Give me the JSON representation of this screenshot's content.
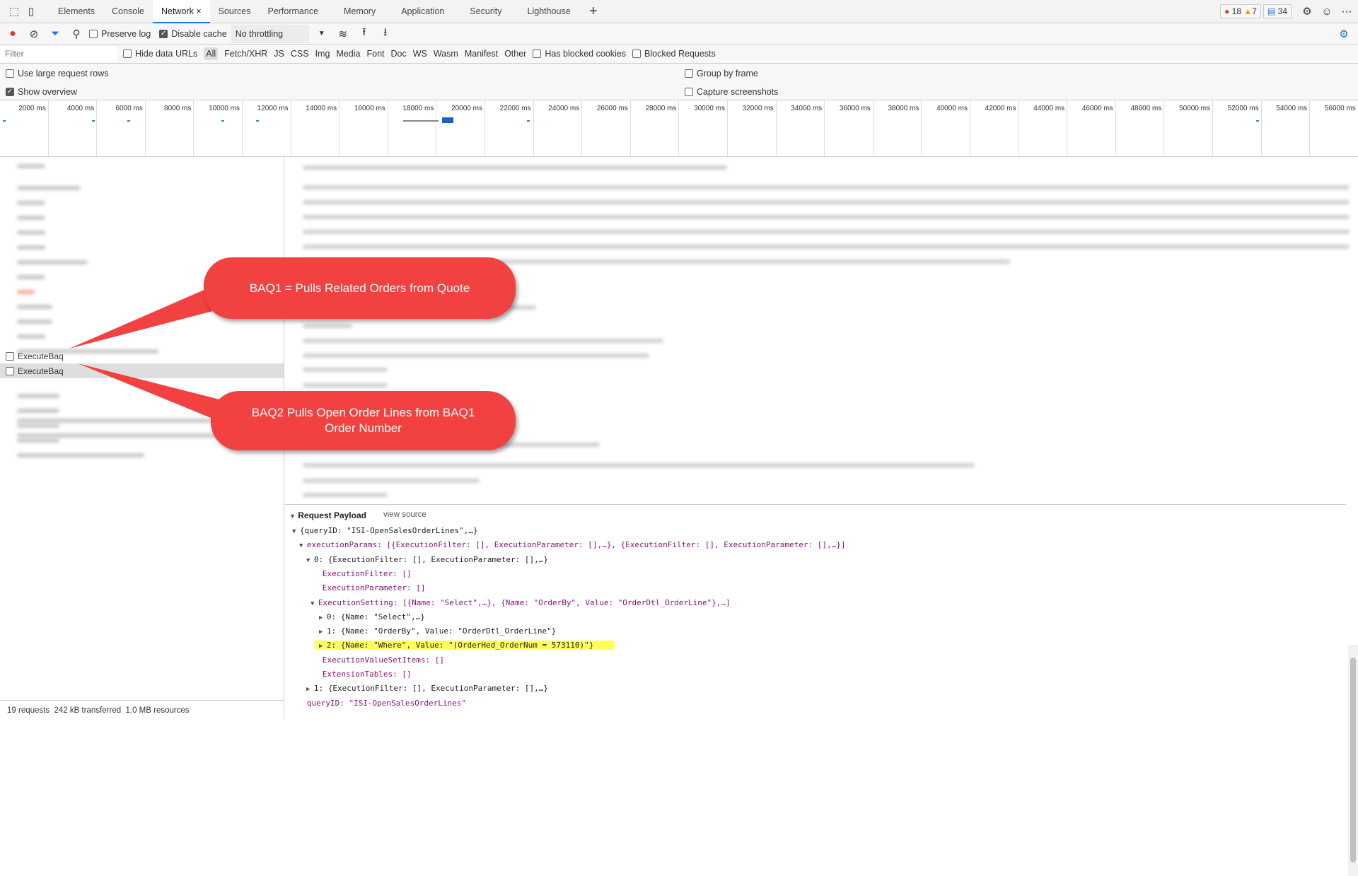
{
  "tabs": [
    "Elements",
    "Console",
    "Network",
    "Sources",
    "Performance",
    "Memory",
    "Application",
    "Security",
    "Lighthouse"
  ],
  "active_tab": "Network",
  "badges": {
    "errors": "18",
    "warnings": "7",
    "messages": "34"
  },
  "toolbar": {
    "preserve_log": "Preserve log",
    "disable_cache": "Disable cache",
    "throttling": "No throttling"
  },
  "filter": {
    "placeholder": "Filter",
    "hide_data_urls": "Hide data URLs",
    "types": [
      "All",
      "Fetch/XHR",
      "JS",
      "CSS",
      "Img",
      "Media",
      "Font",
      "Doc",
      "WS",
      "Wasm",
      "Manifest",
      "Other"
    ],
    "has_blocked_cookies": "Has blocked cookies",
    "blocked_requests": "Blocked Requests"
  },
  "options": {
    "large_rows": "Use large request rows",
    "show_overview": "Show overview",
    "group_by_frame": "Group by frame",
    "capture_screenshots": "Capture screenshots"
  },
  "timeline_ticks": [
    "2000 ms",
    "4000 ms",
    "6000 ms",
    "8000 ms",
    "10000 ms",
    "12000 ms",
    "14000 ms",
    "16000 ms",
    "18000 ms",
    "20000 ms",
    "22000 ms",
    "24000 ms",
    "26000 ms",
    "28000 ms",
    "30000 ms",
    "32000 ms",
    "34000 ms",
    "36000 ms",
    "38000 ms",
    "40000 ms",
    "42000 ms",
    "44000 ms",
    "46000 ms",
    "48000 ms",
    "50000 ms",
    "52000 ms",
    "54000 ms",
    "56000 ms"
  ],
  "requests": {
    "row1": "ExecuteBaq",
    "row2": "ExecuteBaq"
  },
  "status": {
    "requests": "19 requests",
    "transferred": "242 kB transferred",
    "resources": "1.0 MB resources"
  },
  "payload": {
    "title": "Request Payload",
    "view_source": "view source",
    "lines": [
      "{queryID: \"ISI-OpenSalesOrderLines\",…}",
      "executionParams: [{ExecutionFilter: [], ExecutionParameter: [],…}, {ExecutionFilter: [], ExecutionParameter: [],…}]",
      "0: {ExecutionFilter: [], ExecutionParameter: [],…}",
      "ExecutionFilter: []",
      "ExecutionParameter: []",
      "ExecutionSetting: [{Name: \"Select\",…}, {Name: \"OrderBy\", Value: \"OrderDtl_OrderLine\"},…]",
      "0: {Name: \"Select\",…}",
      "1: {Name: \"OrderBy\", Value: \"OrderDtl_OrderLine\"}",
      "2: {Name: \"Where\", Value: \"(OrderHed_OrderNum = 573110)\"}",
      "ExecutionValueSetItems: []",
      "ExtensionTables: []",
      "1: {ExecutionFilter: [], ExecutionParameter: [],…}",
      "queryID: \"ISI-OpenSalesOrderLines\""
    ]
  },
  "callouts": {
    "baq1": "BAQ1 = Pulls Related Orders from Quote",
    "baq2": "BAQ2 Pulls Open Order Lines from BAQ1 Order Number"
  },
  "colors": {
    "callout": "#f24141",
    "highlight": "#ffff5a",
    "accent": "#1a73e8"
  }
}
